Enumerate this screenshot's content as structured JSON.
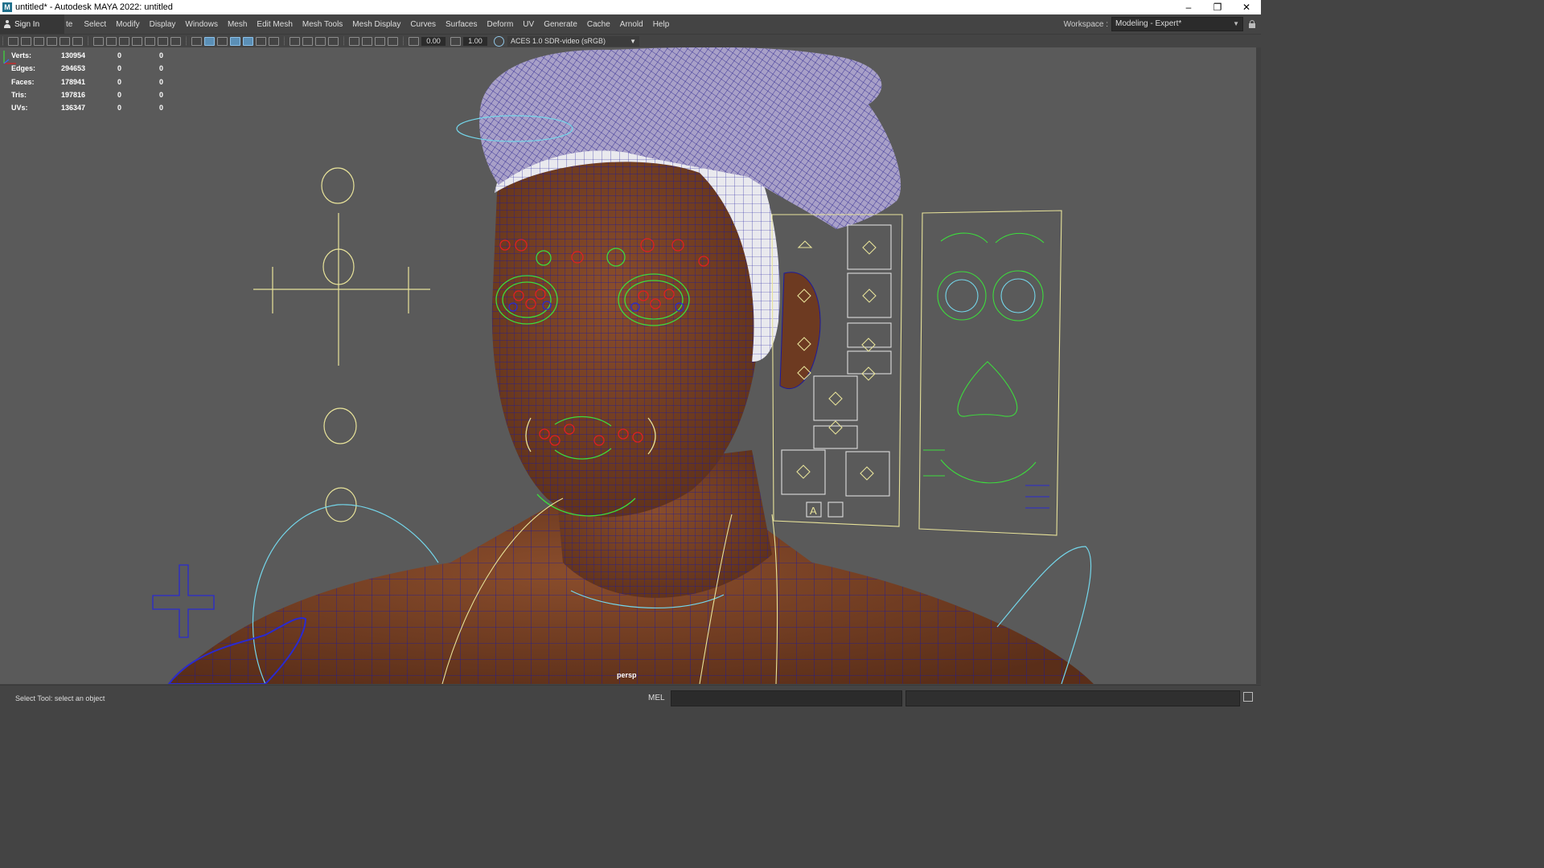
{
  "window": {
    "title": "untitled* - Autodesk MAYA 2022: untitled",
    "controls": [
      "–",
      "❐",
      "✕"
    ]
  },
  "menubar": {
    "sign_in": "Sign In",
    "cut_item": "te",
    "items": [
      "Select",
      "Modify",
      "Display",
      "Windows",
      "Mesh",
      "Edit Mesh",
      "Mesh Tools",
      "Mesh Display",
      "Curves",
      "Surfaces",
      "Deform",
      "UV",
      "Generate",
      "Cache",
      "Arnold",
      "Help"
    ],
    "workspace_label": "Workspace :",
    "workspace_value": "Modeling - Expert*"
  },
  "toolbar": {
    "field1": "0.00",
    "field2": "1.00",
    "color_space": "ACES 1.0 SDR-video (sRGB)"
  },
  "hud": {
    "rows": [
      {
        "label": "Verts:",
        "a": "130954",
        "b": "0",
        "c": "0"
      },
      {
        "label": "Edges:",
        "a": "294653",
        "b": "0",
        "c": "0"
      },
      {
        "label": "Faces:",
        "a": "178941",
        "b": "0",
        "c": "0"
      },
      {
        "label": "Tris:",
        "a": "197816",
        "b": "0",
        "c": "0"
      },
      {
        "label": "UVs:",
        "a": "136347",
        "b": "0",
        "c": "0"
      }
    ]
  },
  "viewport": {
    "camera": "persp",
    "control_panel_text": "A",
    "colors": {
      "wire": "#1d1a9e",
      "skin": "#6e3b22",
      "control_yellow": "#e8e39a",
      "control_green": "#3ddc3d",
      "control_red": "#e02020",
      "control_cyan": "#74d6ea"
    }
  },
  "statusbar": {
    "help_text": "Select Tool: select an object",
    "mel_label": "MEL"
  }
}
